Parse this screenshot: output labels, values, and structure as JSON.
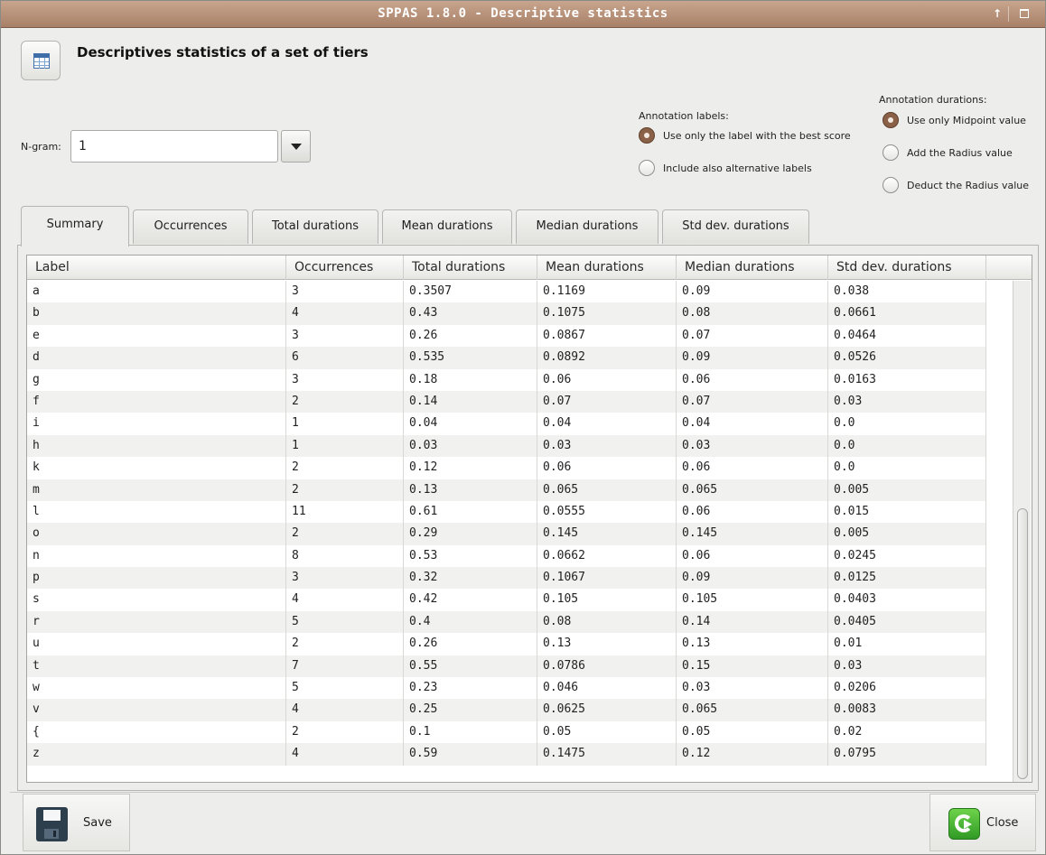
{
  "window": {
    "title": "SPPAS 1.8.0  - Descriptive statistics",
    "title_color": "#a88067"
  },
  "header": {
    "icon": "spreadsheet-icon",
    "title": "Descriptives statistics of a set of tiers"
  },
  "ngram": {
    "label": "N-gram:",
    "value": "1"
  },
  "annotation_labels": {
    "label": "Annotation labels:",
    "options": [
      {
        "text": "Use only the label with the best score",
        "selected": true
      },
      {
        "text": "Include also alternative labels",
        "selected": false
      }
    ]
  },
  "annotation_durations": {
    "label": "Annotation durations:",
    "options": [
      {
        "text": "Use only Midpoint value",
        "selected": true
      },
      {
        "text": "Add the Radius value",
        "selected": false
      },
      {
        "text": "Deduct the Radius value",
        "selected": false
      }
    ]
  },
  "tabs": [
    {
      "label": "Summary",
      "active": true
    },
    {
      "label": "Occurrences",
      "active": false
    },
    {
      "label": "Total durations",
      "active": false
    },
    {
      "label": "Mean durations",
      "active": false
    },
    {
      "label": "Median durations",
      "active": false
    },
    {
      "label": "Std dev. durations",
      "active": false
    }
  ],
  "table": {
    "columns": [
      "Label",
      "Occurrences",
      "Total durations",
      "Mean durations",
      "Median durations",
      "Std dev. durations"
    ],
    "rows": [
      [
        "a",
        "3",
        "0.3507",
        "0.1169",
        "0.09",
        "0.038"
      ],
      [
        "b",
        "4",
        "0.43",
        "0.1075",
        "0.08",
        "0.0661"
      ],
      [
        "e",
        "3",
        "0.26",
        "0.0867",
        "0.07",
        "0.0464"
      ],
      [
        "d",
        "6",
        "0.535",
        "0.0892",
        "0.09",
        "0.0526"
      ],
      [
        "g",
        "3",
        "0.18",
        "0.06",
        "0.06",
        "0.0163"
      ],
      [
        "f",
        "2",
        "0.14",
        "0.07",
        "0.07",
        "0.03"
      ],
      [
        "i",
        "1",
        "0.04",
        "0.04",
        "0.04",
        "0.0"
      ],
      [
        "h",
        "1",
        "0.03",
        "0.03",
        "0.03",
        "0.0"
      ],
      [
        "k",
        "2",
        "0.12",
        "0.06",
        "0.06",
        "0.0"
      ],
      [
        "m",
        "2",
        "0.13",
        "0.065",
        "0.065",
        "0.005"
      ],
      [
        "l",
        "11",
        "0.61",
        "0.0555",
        "0.06",
        "0.015"
      ],
      [
        "o",
        "2",
        "0.29",
        "0.145",
        "0.145",
        "0.005"
      ],
      [
        "n",
        "8",
        "0.53",
        "0.0662",
        "0.06",
        "0.0245"
      ],
      [
        "p",
        "3",
        "0.32",
        "0.1067",
        "0.09",
        "0.0125"
      ],
      [
        "s",
        "4",
        "0.42",
        "0.105",
        "0.105",
        "0.0403"
      ],
      [
        "r",
        "5",
        "0.4",
        "0.08",
        "0.14",
        "0.0405"
      ],
      [
        "u",
        "2",
        "0.26",
        "0.13",
        "0.13",
        "0.01"
      ],
      [
        "t",
        "7",
        "0.55",
        "0.0786",
        "0.15",
        "0.03"
      ],
      [
        "w",
        "5",
        "0.23",
        "0.046",
        "0.03",
        "0.0206"
      ],
      [
        "v",
        "4",
        "0.25",
        "0.0625",
        "0.065",
        "0.0083"
      ],
      [
        "{",
        "2",
        "0.1",
        "0.05",
        "0.05",
        "0.02"
      ],
      [
        "z",
        "4",
        "0.59",
        "0.1475",
        "0.12",
        "0.0795"
      ]
    ]
  },
  "footer": {
    "save_label": "Save",
    "save_icon": "save-icon",
    "close_label": "Close",
    "close_icon": "close-icon"
  },
  "colors": {
    "radio_selected": "#8a6147",
    "close_icon": "#3fae2f"
  }
}
